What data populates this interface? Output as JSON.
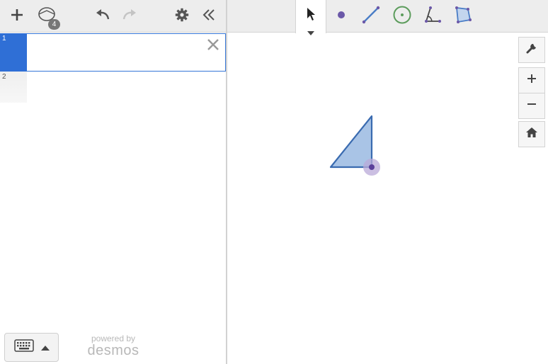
{
  "expressions": {
    "rows": [
      {
        "number": "1",
        "value": ""
      },
      {
        "number": "2",
        "value": ""
      }
    ]
  },
  "toolbar": {
    "object_count": "4",
    "icons": [
      "plus-icon",
      "objects-icon",
      "undo-icon",
      "redo-icon",
      "gear-icon",
      "collapse-icon"
    ]
  },
  "geometry_tools": [
    "select-tool",
    "point-tool",
    "segment-tool",
    "circle-tool",
    "angle-tool",
    "polygon-tool"
  ],
  "graph_controls": [
    "wrench-icon",
    "zoom-in-icon",
    "zoom-out-icon",
    "home-icon"
  ],
  "branding": {
    "powered_by": "powered by",
    "brand": "desmos"
  },
  "colors": {
    "accent_blue": "#2f6fd6",
    "shape_fill": "#a9c4e6",
    "shape_stroke": "#3a6bb0",
    "point_purple": "#6b58a8",
    "circle_green": "#5c9c5c"
  }
}
